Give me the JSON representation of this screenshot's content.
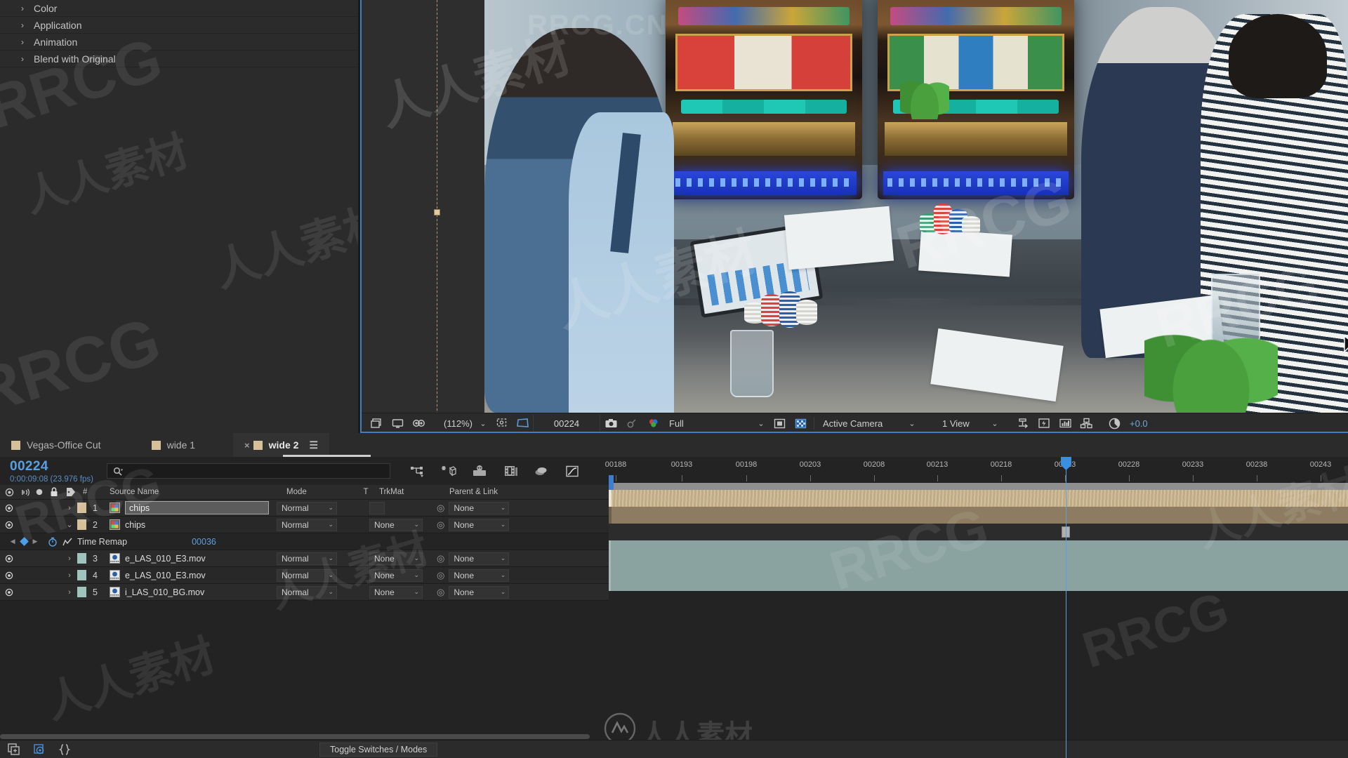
{
  "effects_panel": {
    "items": [
      {
        "label": "Color",
        "twirl": "›"
      },
      {
        "label": "Application",
        "twirl": "›"
      },
      {
        "label": "Animation",
        "twirl": "›"
      },
      {
        "label": "Blend with Original",
        "twirl": "›"
      }
    ]
  },
  "viewer": {
    "zoom": "(112%)",
    "timecode": "00224",
    "resolution": "Full",
    "camera": "Active Camera",
    "views": "1 View",
    "exposure": "+0.0",
    "icons": {
      "main_camera": "main-camera-icon",
      "take_snapshot": "snapshot-icon",
      "show_snapshot": "show-snapshot-icon",
      "channel": "channel-rgb-icon",
      "region_of_interest": "region-of-interest-icon",
      "transparency_grid": "transparency-grid-icon",
      "toggle_mask": "toggle-mask-icon",
      "toggle_view_layout": "toggle-view-layout-icon",
      "timeline_graph": "timeline-graph-icon",
      "renderer": "renderer-icon",
      "exposure": "exposure-icon",
      "fast_preview": "fast-preview-icon",
      "grid_guides": "grid-guides-icon",
      "pixel_aspect": "pixel-aspect-icon",
      "zoom_caret": "chevron-down-icon",
      "resolution_caret": "chevron-down-icon",
      "camera_caret": "chevron-down-icon",
      "views_caret": "chevron-down-icon"
    }
  },
  "timeline": {
    "tabs": [
      {
        "label": "Vegas-Office Cut",
        "active": false,
        "closable": false
      },
      {
        "label": "wide 1",
        "active": false,
        "closable": false
      },
      {
        "label": "wide 2",
        "active": true,
        "closable": true
      }
    ],
    "current_time": "00224",
    "current_time_sub": "0:00:09:08 (23.976 fps)",
    "search_placeholder": "",
    "search_value": "",
    "toolbar_icons": [
      "composition-mini-flowchart-icon",
      "draft-3d-icon",
      "hide-shy-layers-icon",
      "frame-blending-icon",
      "motion-blur-icon",
      "graph-editor-icon"
    ],
    "columns": {
      "eye": "video-toggle-icon",
      "audio": "audio-toggle-icon",
      "solo": "solo-toggle-icon",
      "lock": "lock-toggle-icon",
      "tag": "label-tag-icon",
      "number": "#",
      "source_name": "Source Name",
      "mode": "Mode",
      "t": "T",
      "trkmat": "TrkMat",
      "parent": "Parent & Link"
    },
    "layers": [
      {
        "index": "1",
        "name": "chips",
        "editing": true,
        "expanded": false,
        "mode": "Normal",
        "trkmat": "",
        "parent": "None",
        "swatch": "#d6c09a",
        "bar": "#ccb68f"
      },
      {
        "index": "2",
        "name": "chips",
        "editing": false,
        "expanded": true,
        "mode": "Normal",
        "trkmat": "None",
        "parent": "None",
        "swatch": "#d6c09a",
        "bar": "#8d7c62"
      },
      {
        "index": "3",
        "name": "e_LAS_010_E3.mov",
        "editing": false,
        "expanded": false,
        "mode": "Normal",
        "trkmat": "None",
        "parent": "None",
        "swatch": "#9ec4bd",
        "bar": "#8aa3a0"
      },
      {
        "index": "4",
        "name": "e_LAS_010_E3.mov",
        "editing": false,
        "expanded": false,
        "mode": "Normal",
        "trkmat": "None",
        "parent": "None",
        "swatch": "#9ec4bd",
        "bar": "#8aa3a0"
      },
      {
        "index": "5",
        "name": "i_LAS_010_BG.mov",
        "editing": false,
        "expanded": false,
        "mode": "Normal",
        "trkmat": "None",
        "parent": "None",
        "swatch": "#9ec4bd",
        "bar": "#8aa3a0"
      }
    ],
    "time_remap": {
      "label": "Time Remap",
      "value": "00036"
    },
    "ruler_ticks": [
      "00188",
      "00193",
      "00198",
      "00203",
      "00208",
      "00213",
      "00218",
      "00223",
      "00228",
      "00233",
      "00238",
      "00243"
    ],
    "playhead_label": "00223",
    "bottom": {
      "toggle_label": "Toggle Switches / Modes",
      "icons": [
        "new-composition-icon",
        "composition-settings-icon",
        "motion-graphics-icon"
      ]
    }
  },
  "watermarks": {
    "rrcg": "RRCG",
    "rrcg_cn": "RRCG.CN",
    "renren": "人人素材"
  },
  "colors": {
    "accent_blue": "#5a9fe0",
    "panel_bg": "#2b2b2b",
    "timeline_bg": "#232323",
    "layer_tan": "#ccb68f",
    "layer_teal": "#8aa3a0",
    "keyframe_blue": "#4a9eea"
  }
}
